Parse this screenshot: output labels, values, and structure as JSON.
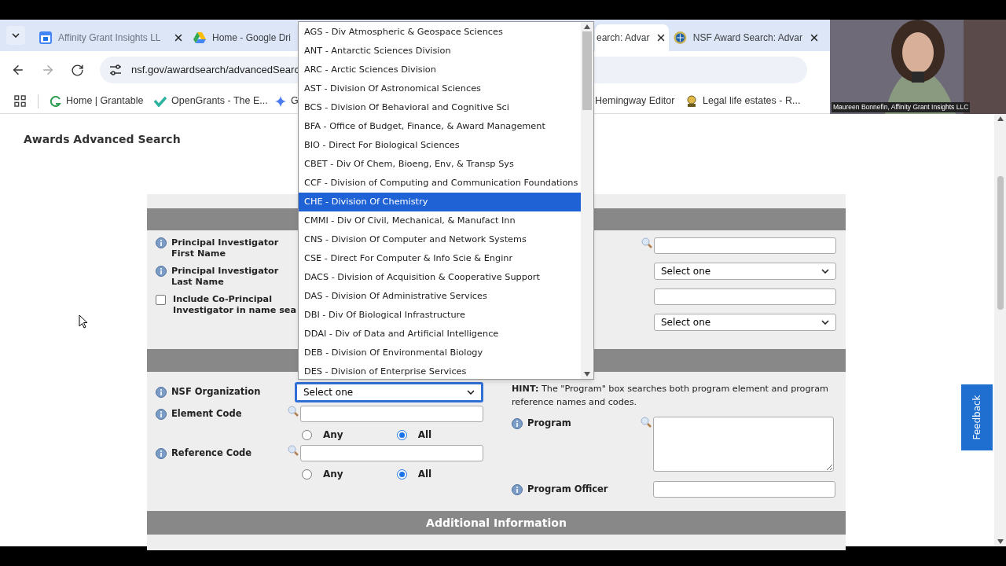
{
  "browser": {
    "tabs": [
      {
        "label": "Affinity Grant Insights LL",
        "selected": false
      },
      {
        "label": "Home - Google Dri",
        "selected": false
      },
      {
        "label": "earch: Advar",
        "selected": true
      },
      {
        "label": "NSF Award Search: Advar",
        "selected": false
      }
    ],
    "url": "nsf.gov/awardsearch/advancedSearc",
    "bookmarks": [
      {
        "label": "Home | Grantable"
      },
      {
        "label": "OpenGrants - The E..."
      },
      {
        "label": "G"
      },
      {
        "label": "Hemingway Editor"
      },
      {
        "label": "Legal life estates - R..."
      }
    ]
  },
  "page": {
    "title": "Awards Advanced Search",
    "section1": {
      "left_rows": [
        {
          "label": "Principal Investigator First Name",
          "kind": "info"
        },
        {
          "label": "Principal Investigator Last Name",
          "kind": "info"
        },
        {
          "label": "Include Co-Principal Investigator in name sea",
          "kind": "checkbox",
          "checked": false
        }
      ],
      "right_fields": [
        {
          "kind": "search"
        },
        {
          "kind": "select",
          "value": "Select one"
        },
        {
          "kind": "input"
        },
        {
          "kind": "select",
          "value": "Select one"
        }
      ]
    },
    "section2": {
      "org_label": "NSF Organization",
      "org_value": "Select one",
      "codes": [
        {
          "label": "Element Code",
          "radios": [
            {
              "label": "Any",
              "selected": false
            },
            {
              "label": "All",
              "selected": true
            }
          ]
        },
        {
          "label": "Reference Code",
          "radios": [
            {
              "label": "Any",
              "selected": false
            },
            {
              "label": "All",
              "selected": true
            }
          ]
        }
      ],
      "hint_bold": "HINT:",
      "hint": "The \"Program\" box searches both program element and program reference names and codes.",
      "program_label": "Program",
      "officer_label": "Program Officer"
    },
    "section3_title": "Additional Information"
  },
  "org_dropdown": [
    {
      "label": "AGS - Div Atmospheric & Geospace Sciences",
      "selected": false
    },
    {
      "label": "ANT - Antarctic Sciences Division",
      "selected": false
    },
    {
      "label": "ARC - Arctic Sciences Division",
      "selected": false
    },
    {
      "label": "AST - Division Of Astronomical Sciences",
      "selected": false
    },
    {
      "label": "BCS - Division Of Behavioral and Cognitive Sci",
      "selected": false
    },
    {
      "label": "BFA - Office of Budget, Finance, & Award Management",
      "selected": false
    },
    {
      "label": "BIO - Direct For Biological Sciences",
      "selected": false
    },
    {
      "label": "CBET - Div Of Chem, Bioeng, Env, & Transp Sys",
      "selected": false
    },
    {
      "label": "CCF - Division of Computing and Communication Foundations",
      "selected": false
    },
    {
      "label": "CHE - Division Of Chemistry",
      "selected": true
    },
    {
      "label": "CMMI - Div Of Civil, Mechanical, & Manufact Inn",
      "selected": false
    },
    {
      "label": "CNS - Division Of Computer and Network Systems",
      "selected": false
    },
    {
      "label": "CSE - Direct For Computer & Info Scie & Enginr",
      "selected": false
    },
    {
      "label": "DACS - Division of Acquisition & Cooperative Support",
      "selected": false
    },
    {
      "label": "DAS - Division Of Administrative Services",
      "selected": false
    },
    {
      "label": "DBI - Div Of Biological Infrastructure",
      "selected": false
    },
    {
      "label": "DDAI - Div of Data and Artificial Intelligence",
      "selected": false
    },
    {
      "label": "DEB - Division Of Environmental Biology",
      "selected": false
    },
    {
      "label": "DES - Division of Enterprise Services",
      "selected": false
    }
  ],
  "video": {
    "caption": "Maureen Bonnefin, Affinity Grant Insights LLC"
  },
  "feedback": "Feedback"
}
